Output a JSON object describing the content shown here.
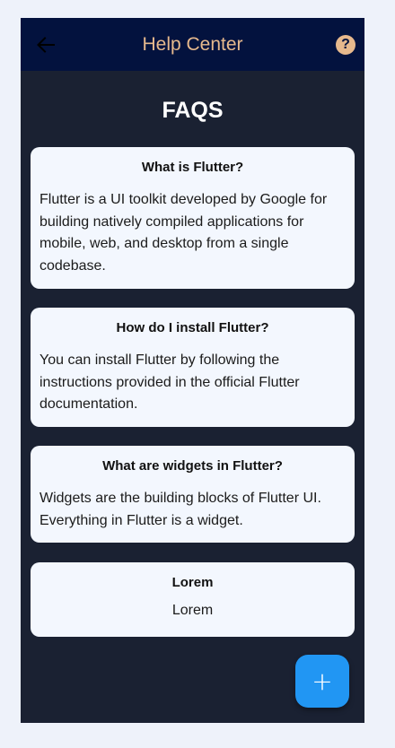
{
  "appbar": {
    "title": "Help Center",
    "back_icon": "arrow-left-icon",
    "help_icon": "question-circle-icon",
    "help_glyph": "?"
  },
  "page": {
    "title": "FAQS"
  },
  "faqs": [
    {
      "question": "What is Flutter?",
      "answer": "Flutter is a UI toolkit developed by Google for building natively compiled applications for mobile, web, and desktop from a single codebase."
    },
    {
      "question": "How do I install Flutter?",
      "answer": "You can install Flutter by following the instructions provided in the official Flutter documentation."
    },
    {
      "question": "What are widgets in Flutter?",
      "answer": "Widgets are the building blocks of Flutter UI. Everything in Flutter is a widget."
    },
    {
      "question": "Lorem",
      "answer": "Lorem"
    }
  ],
  "fab": {
    "icon": "plus-icon",
    "glyph": "+"
  },
  "colors": {
    "background": "#1a2132",
    "appbar": "#03123e",
    "accent": "#e7b98d",
    "card": "#f3f7fe",
    "fab": "#2196f3"
  }
}
